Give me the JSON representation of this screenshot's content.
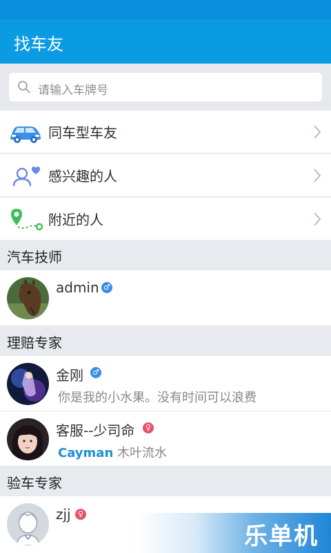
{
  "header": {
    "title": "找车友"
  },
  "search": {
    "placeholder": "请输入车牌号",
    "icon": "search-icon"
  },
  "menu": [
    {
      "label": "同车型车友",
      "icon": "car-icon"
    },
    {
      "label": "感兴趣的人",
      "icon": "person-heart-icon"
    },
    {
      "label": "附近的人",
      "icon": "location-route-icon"
    }
  ],
  "sections": [
    {
      "title": "汽车技师",
      "users": [
        {
          "name": "admin",
          "gender": "male"
        }
      ]
    },
    {
      "title": "理赔专家",
      "users": [
        {
          "name": "金刚",
          "gender": "male",
          "subtitle": "你是我的小水果。没有时间可以浪费"
        },
        {
          "name": "客服--少司命",
          "gender": "female",
          "subtitle_highlight": "Cayman",
          "subtitle": "木叶流水"
        }
      ]
    },
    {
      "title": "验车专家",
      "users": [
        {
          "name": "zjj",
          "gender": "female"
        }
      ]
    }
  ],
  "watermark": {
    "text": "乐单机"
  },
  "colors": {
    "primary": "#0b9be3",
    "male": "#3b8fe0",
    "female": "#e7536b",
    "highlight": "#1d8fd3"
  }
}
